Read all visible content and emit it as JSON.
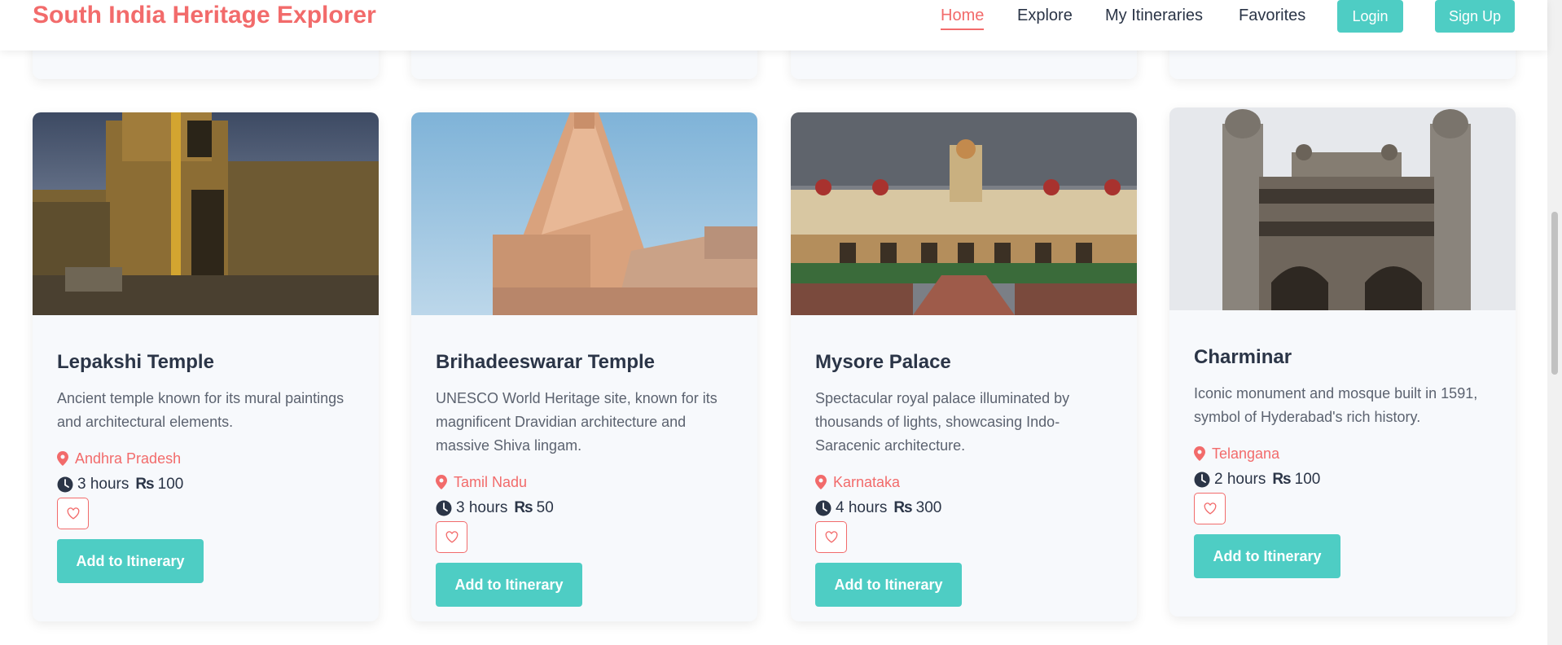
{
  "header": {
    "brand": "South India Heritage Explorer",
    "nav": [
      "Home",
      "Explore",
      "My Itineraries",
      "Favorites"
    ],
    "active_nav": "Home",
    "login_label": "Login",
    "signup_label": "Sign Up"
  },
  "colors": {
    "brand": "#f26b6b",
    "accent": "#4ecdc4",
    "text_dark": "#2b3547",
    "card_bg": "#f7f9fc"
  },
  "cards": [
    {
      "title": "Lepakshi Temple",
      "description": "Ancient temple known for its mural paintings and architectural elements.",
      "location": "Andhra Pradesh",
      "duration": "3 hours",
      "currency": "₨",
      "price": "100",
      "add_label": "Add to Itinerary",
      "location_icon": "map-pin-icon",
      "duration_icon": "clock-icon",
      "favorite_icon": "heart-icon"
    },
    {
      "title": "Brihadeeswarar Temple",
      "description": "UNESCO World Heritage site, known for its magnificent Dravidian architecture and massive Shiva lingam.",
      "location": "Tamil Nadu",
      "duration": "3 hours",
      "currency": "₨",
      "price": "50",
      "add_label": "Add to Itinerary",
      "location_icon": "map-pin-icon",
      "duration_icon": "clock-icon",
      "favorite_icon": "heart-icon"
    },
    {
      "title": "Mysore Palace",
      "description": "Spectacular royal palace illuminated by thousands of lights, showcasing Indo-Saracenic architecture.",
      "location": "Karnataka",
      "duration": "4 hours",
      "currency": "₨",
      "price": "300",
      "add_label": "Add to Itinerary",
      "location_icon": "map-pin-icon",
      "duration_icon": "clock-icon",
      "favorite_icon": "heart-icon"
    },
    {
      "title": "Charminar",
      "description": "Iconic monument and mosque built in 1591, symbol of Hyderabad's rich history.",
      "location": "Telangana",
      "duration": "2 hours",
      "currency": "₨",
      "price": "100",
      "add_label": "Add to Itinerary",
      "location_icon": "map-pin-icon",
      "duration_icon": "clock-icon",
      "favorite_icon": "heart-icon"
    }
  ]
}
